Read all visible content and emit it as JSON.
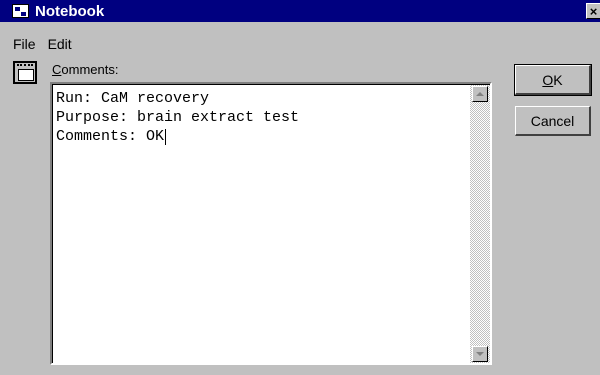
{
  "window": {
    "title": "Notebook",
    "close_glyph": "×",
    "titlebar_color": "#000080",
    "face_color": "#c0c0c0"
  },
  "menubar": {
    "items": [
      {
        "label": "File"
      },
      {
        "label": "Edit"
      }
    ]
  },
  "icons": {
    "app": "notebook-app-icon",
    "notebook": "notebook-icon",
    "close": "close-icon",
    "scroll_up": "arrow-up-icon",
    "scroll_down": "arrow-down-icon"
  },
  "comments": {
    "label_mnemonic": "C",
    "label_rest": "omments:",
    "lines": [
      "Run: CaM recovery",
      "Purpose: brain extract test",
      "Comments: OK"
    ]
  },
  "buttons": {
    "ok_mnemonic": "O",
    "ok_rest": "K",
    "cancel": "Cancel"
  }
}
